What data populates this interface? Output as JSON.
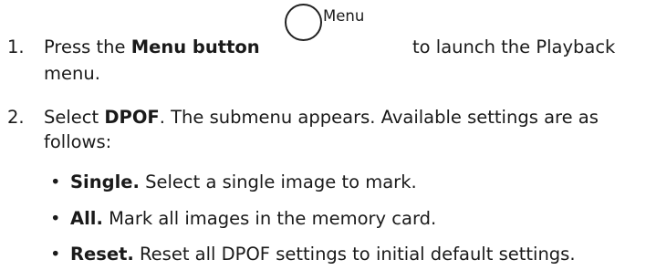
{
  "steps": [
    {
      "number": "1.",
      "pre": "Press the ",
      "bold": "Menu button",
      "icon_label": "Menu",
      "post": " to launch the Playback",
      "cont": "menu."
    },
    {
      "number": "2.",
      "pre": "Select ",
      "bold": "DPOF",
      "post": ". The submenu appears. Available settings are as",
      "cont": "follows:"
    }
  ],
  "bullet_char": "•",
  "settings": [
    {
      "term": "Single.",
      "desc": " Select a single image to mark."
    },
    {
      "term": "All.",
      "desc": " Mark all images in the memory card."
    },
    {
      "term": "Reset.",
      "desc": " Reset all DPOF settings to initial default settings."
    }
  ]
}
